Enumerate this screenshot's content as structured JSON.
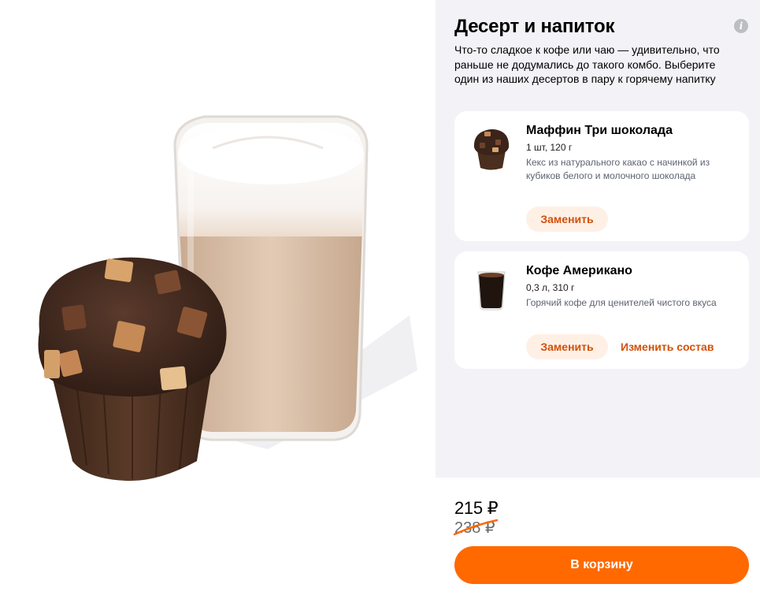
{
  "combo": {
    "title": "Десерт и напиток",
    "description": "Что-то сладкое к кофе или чаю — удивительно, что раньше не додумались до такого комбо. Выберите один из наших десертов в пару к горячему напитку",
    "info_icon": "info-icon"
  },
  "items": [
    {
      "name": "Маффин Три шоколада",
      "size": "1 шт, 120 г",
      "description": "Кекс из натурального какао с начинкой из кубиков белого и молочного шоколада",
      "replace_label": "Заменить"
    },
    {
      "name": "Кофе Американо",
      "size": "0,3 л, 310 г",
      "description": "Горячий кофе для ценителей чистого вкуса",
      "replace_label": "Заменить",
      "edit_label": "Изменить состав"
    }
  ],
  "footer": {
    "price": "215 ₽",
    "old_price": "238 ₽",
    "cart_label": "В корзину"
  },
  "colors": {
    "accent": "#ff6900",
    "accent_text": "#d2500a",
    "button_bg": "#fff0e6",
    "panel_bg": "#f3f3f7"
  }
}
